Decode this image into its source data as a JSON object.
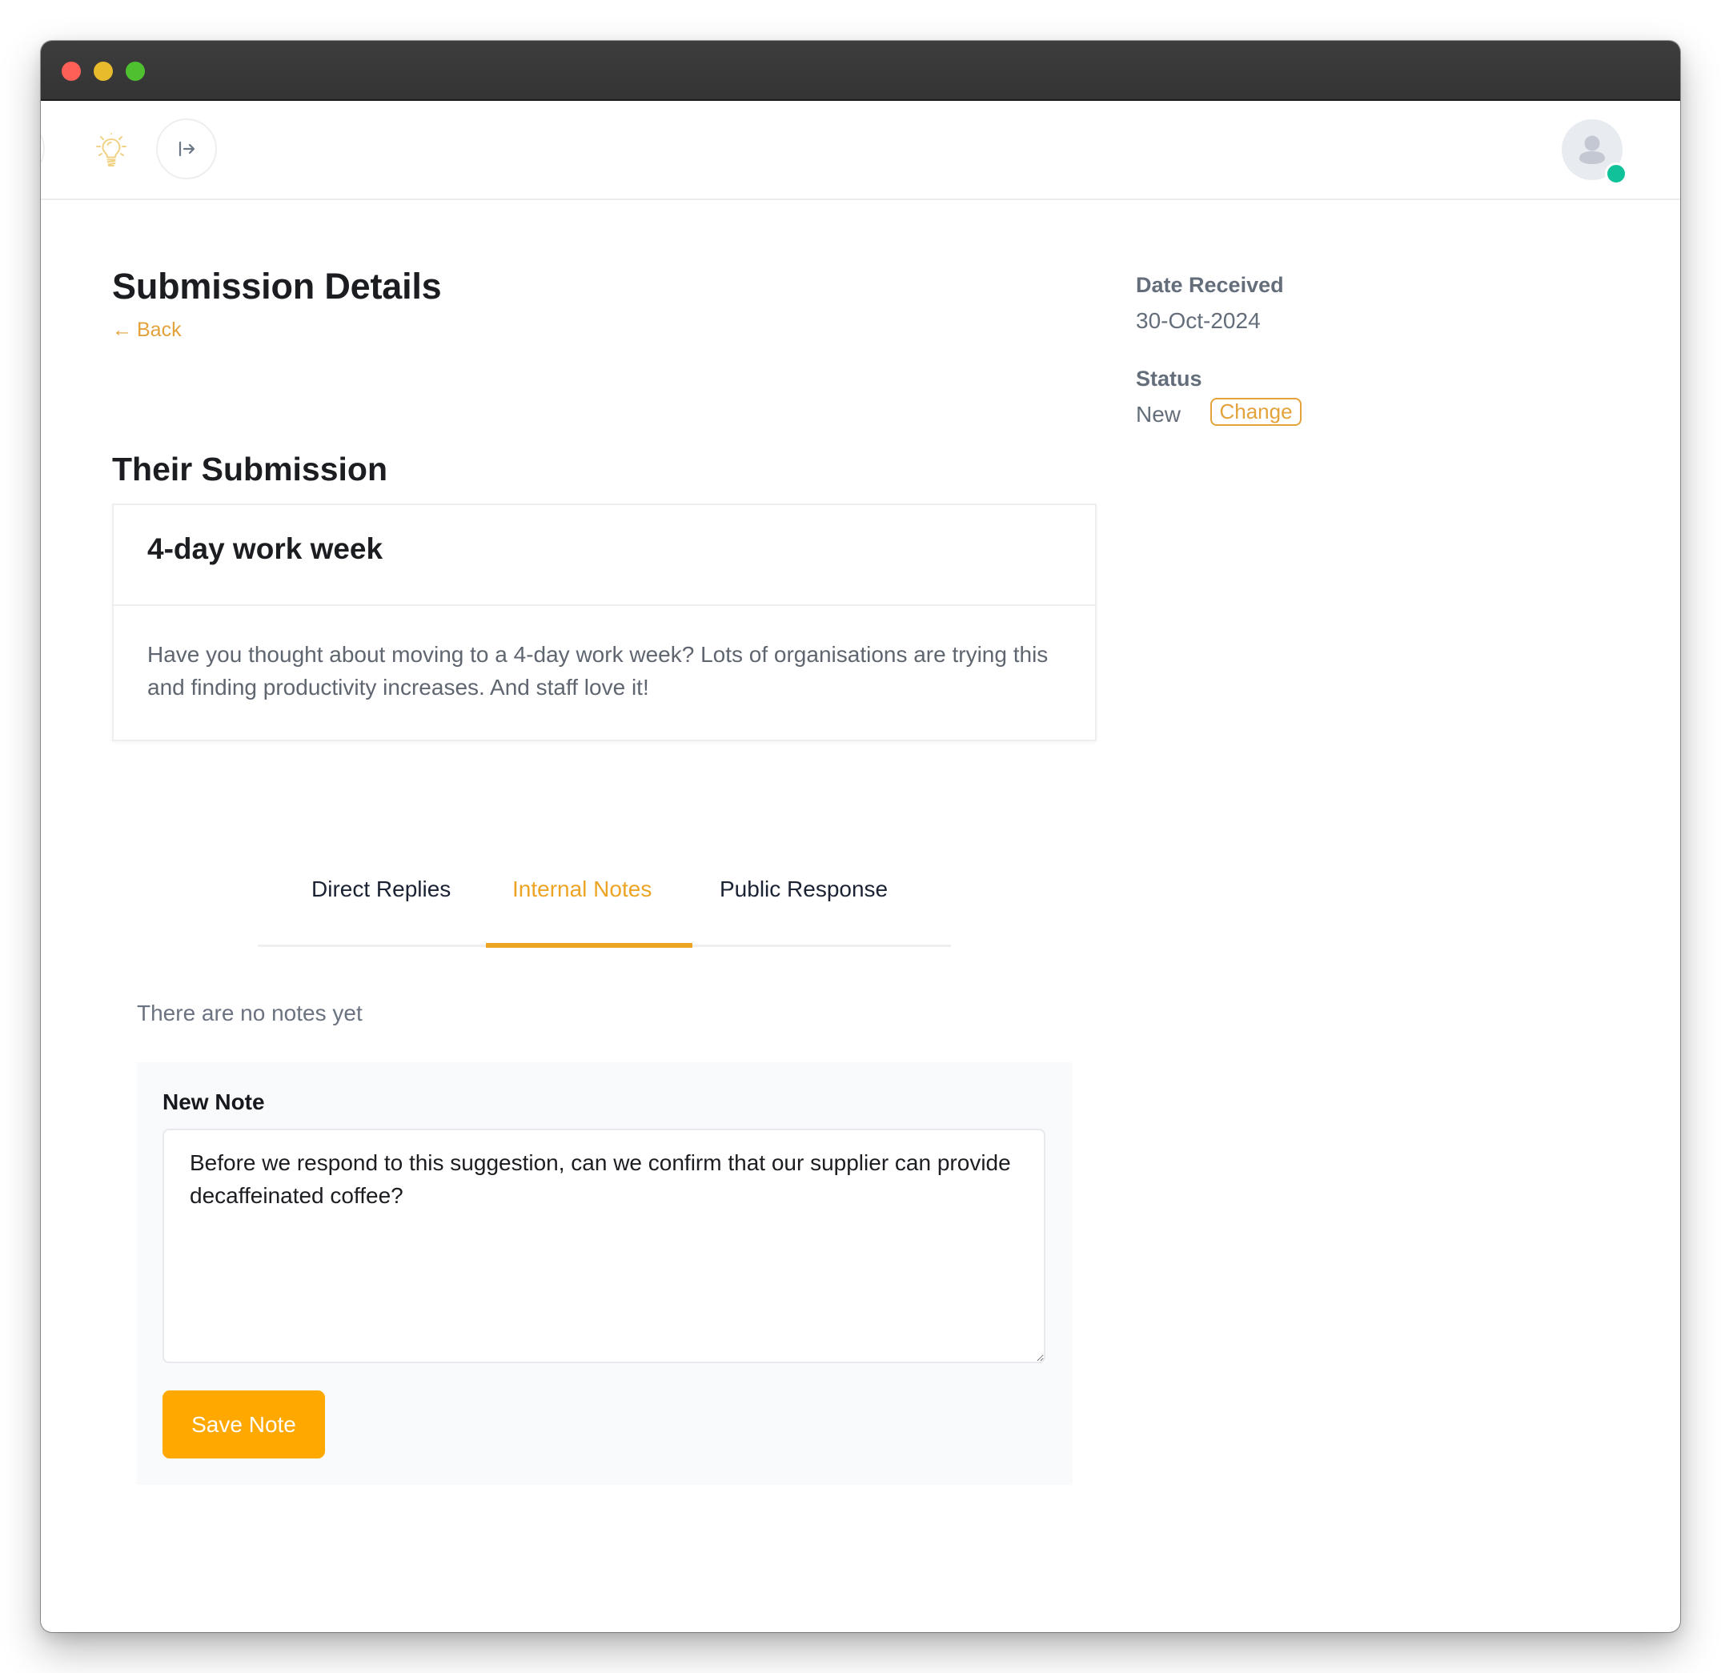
{
  "window": {
    "traffic_lights": [
      "close",
      "minimize",
      "zoom"
    ]
  },
  "header": {
    "logo_icon": "lightbulb-icon",
    "collapse_icon": "sidebar-expand-arrow-icon",
    "avatar_icon": "user-avatar-icon",
    "presence_status": "online"
  },
  "page": {
    "title": "Submission Details",
    "back_label": "Back",
    "back_arrow": "←"
  },
  "meta": {
    "date_label": "Date Received",
    "date_value": "30-Oct-2024",
    "status_label": "Status",
    "status_value": "New",
    "change_label": "Change"
  },
  "submission": {
    "section_title": "Their Submission",
    "title": "4-day work week",
    "body": "Have you thought about moving to a 4-day work week? Lots of organisations are trying this and finding productivity increases. And staff love it!"
  },
  "tabs": [
    {
      "label": "Direct Replies",
      "active": false
    },
    {
      "label": "Internal Notes",
      "active": true
    },
    {
      "label": "Public Response",
      "active": false
    }
  ],
  "notes": {
    "empty_text": "There are no notes yet",
    "new_note_label": "New Note",
    "new_note_value": "Before we respond to this suggestion, can we confirm that our supplier can provide decaffeinated coffee?",
    "save_label": "Save Note"
  },
  "colors": {
    "accent": "#eda425",
    "button": "#ffa800",
    "presence": "#10c29a",
    "titlebar": "#3a3a3a"
  }
}
